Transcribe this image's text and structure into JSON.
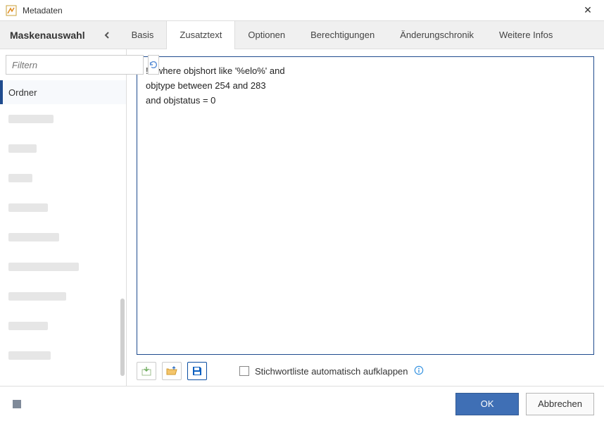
{
  "window": {
    "title": "Metadaten"
  },
  "tabs": {
    "mask_select_label": "Maskenauswahl",
    "items": [
      {
        "label": "Basis",
        "active": false
      },
      {
        "label": "Zusatztext",
        "active": true
      },
      {
        "label": "Optionen",
        "active": false
      },
      {
        "label": "Berechtigungen",
        "active": false
      },
      {
        "label": "Änderungschronik",
        "active": false
      },
      {
        "label": "Weitere Infos",
        "active": false
      }
    ]
  },
  "sidebar": {
    "filter_placeholder": "Filtern",
    "items": [
      {
        "label": "Ordner",
        "selected": true
      }
    ],
    "skeleton_count": 9,
    "skeleton_widths": [
      64,
      40,
      34,
      56,
      72,
      100,
      82,
      56,
      60
    ]
  },
  "editor": {
    "text": "!+ where objshort like '%elo%' and\nobjtype between 254 and 283\nand objstatus = 0"
  },
  "toolbar": {
    "icons": {
      "import": "import-icon",
      "open": "open-icon",
      "save": "save-icon"
    },
    "checkbox_label": "Stichwortliste automatisch aufklappen",
    "checkbox_checked": false
  },
  "footer": {
    "ok_label": "OK",
    "cancel_label": "Abbrechen"
  }
}
